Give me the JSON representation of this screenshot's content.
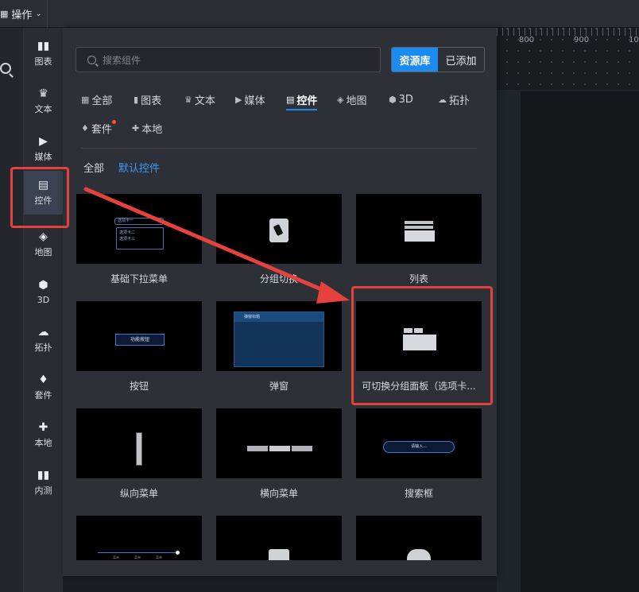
{
  "topbar": {
    "ops_label": "操作"
  },
  "ruler": {
    "labels": [
      "800",
      "900",
      "10"
    ]
  },
  "nav": {
    "items": [
      {
        "label": "图表",
        "icon": "bar-chart-icon"
      },
      {
        "label": "文本",
        "icon": "crown-text-icon"
      },
      {
        "label": "媒体",
        "icon": "media-play-icon"
      },
      {
        "label": "控件",
        "icon": "control-icon"
      },
      {
        "label": "地图",
        "icon": "map-icon"
      },
      {
        "label": "3D",
        "icon": "cube-icon"
      },
      {
        "label": "拓扑",
        "icon": "cloud-icon"
      },
      {
        "label": "套件",
        "icon": "shirt-icon"
      },
      {
        "label": "本地",
        "icon": "puzzle-icon"
      },
      {
        "label": "内测",
        "icon": "bar-chart-icon"
      }
    ],
    "active": "控件"
  },
  "panel": {
    "search_placeholder": "搜索组件",
    "tabs": {
      "library": "资源库",
      "added": "已添加"
    },
    "categories": [
      {
        "label": "全部"
      },
      {
        "label": "图表"
      },
      {
        "label": "文本"
      },
      {
        "label": "媒体"
      },
      {
        "label": "控件"
      },
      {
        "label": "地图"
      },
      {
        "label": "3D"
      },
      {
        "label": "拓扑"
      },
      {
        "label": "套件"
      },
      {
        "label": "本地"
      }
    ],
    "active_category": "控件",
    "subcategories": [
      "全部",
      "默认控件"
    ],
    "cards": [
      {
        "caption": "基础下拉菜单",
        "thumb_texts": [
          "选项卡一",
          "选项卡二",
          "选项卡三"
        ]
      },
      {
        "caption": "分组切换",
        "thumb_texts": []
      },
      {
        "caption": "列表",
        "thumb_texts": []
      },
      {
        "caption": "按钮",
        "thumb_texts": [
          "功能按钮"
        ]
      },
      {
        "caption": "弹窗",
        "thumb_texts": [
          "弹窗标题"
        ]
      },
      {
        "caption": "可切换分组面板（选项卡...",
        "thumb_texts": []
      },
      {
        "caption": "纵向菜单",
        "thumb_texts": []
      },
      {
        "caption": "横向菜单",
        "thumb_texts": []
      },
      {
        "caption": "搜索框",
        "thumb_texts": [
          "请输入..."
        ]
      },
      {
        "caption": "",
        "thumb_texts": [
          "菜单",
          "菜单",
          "菜单"
        ]
      },
      {
        "caption": "",
        "thumb_texts": []
      },
      {
        "caption": "",
        "thumb_texts": []
      }
    ]
  },
  "colors": {
    "accent": "#1c8bef",
    "annotation": "#e5413d"
  }
}
